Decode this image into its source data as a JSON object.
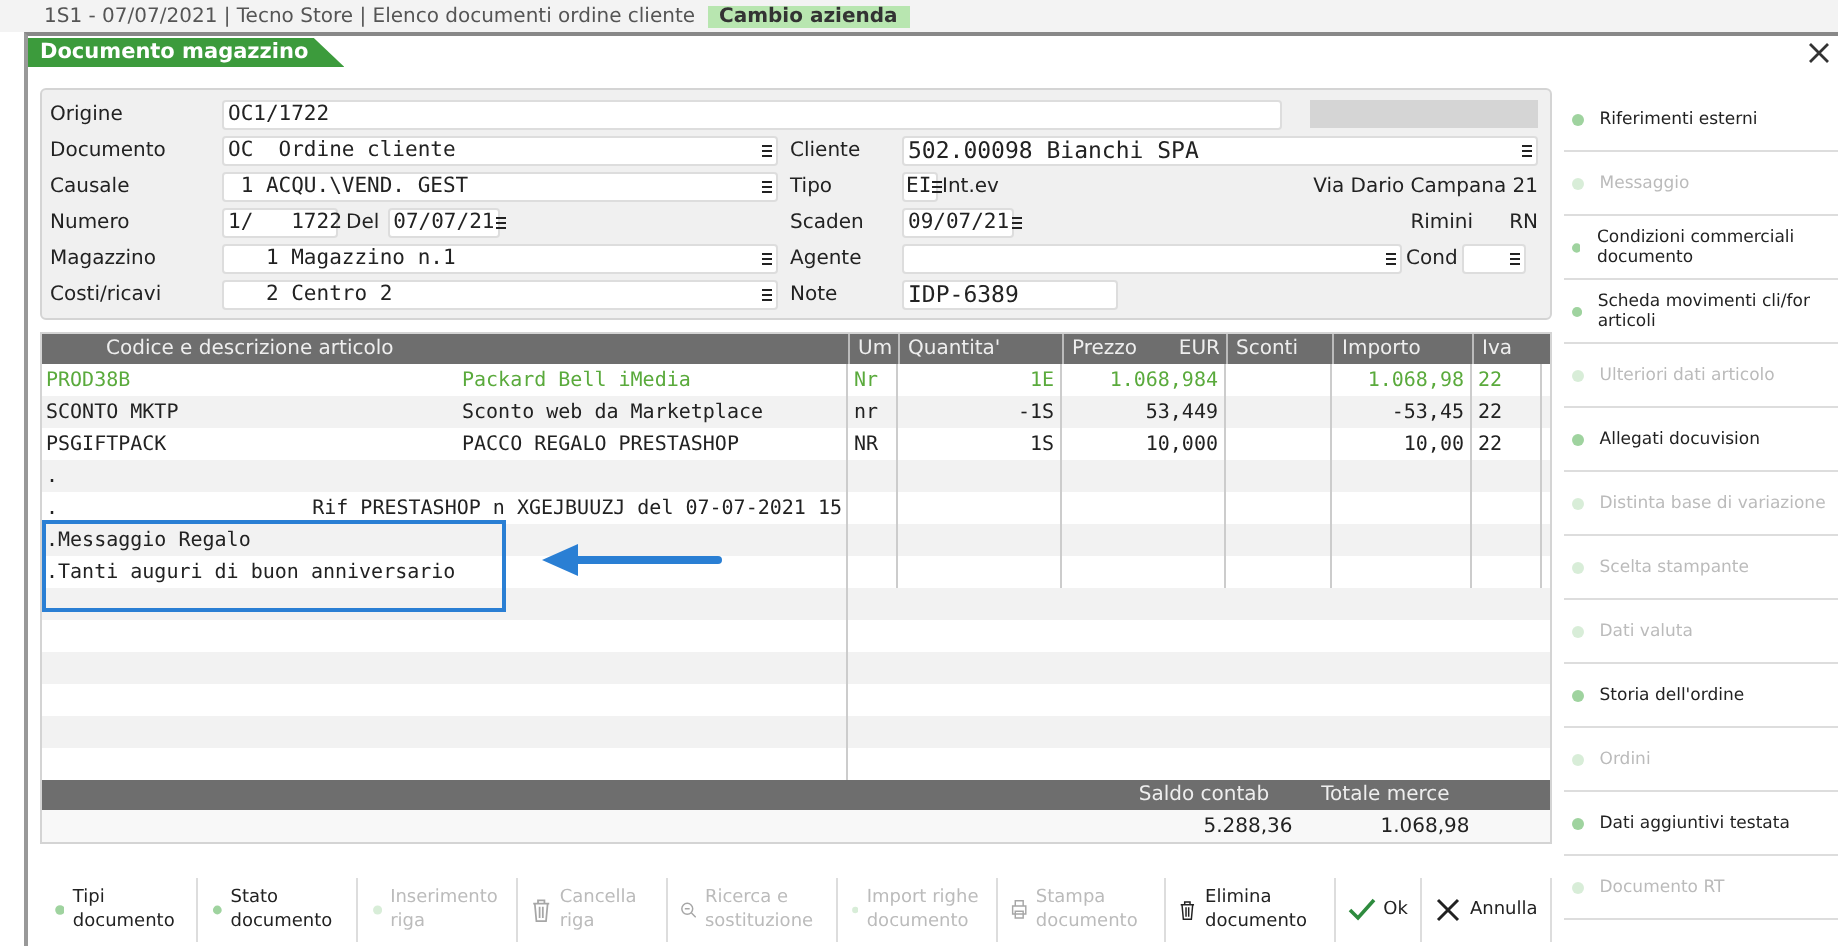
{
  "background_window": {
    "title": "1S1 - 07/07/2021 | Tecno Store | Elenco documenti ordine cliente",
    "action": "Cambio azienda"
  },
  "window": {
    "title": "Documento magazzino"
  },
  "form": {
    "origine": {
      "label": "Origine",
      "value": "OC1/1722"
    },
    "left": [
      {
        "label": "Documento",
        "value": "OC  Ordine cliente",
        "kind": "list"
      },
      {
        "label": "Causale",
        "value": " 1 ACQU.\\VEND. GEST",
        "kind": "list"
      },
      {
        "label": "Numero",
        "value": "1/   1722",
        "kind": "number",
        "date_label": "Del",
        "date": "07/07/21"
      },
      {
        "label": "Magazzino",
        "value": "   1 Magazzino n.1",
        "kind": "list"
      },
      {
        "label": "Costi/ricavi",
        "value": "   2 Centro 2",
        "kind": "list"
      }
    ],
    "right": [
      {
        "label": "Cliente",
        "value": "502.00098 Bianchi SPA",
        "kind": "list"
      },
      {
        "label": "Tipo",
        "value": "EI",
        "kind": "code",
        "text": "Int.ev",
        "extra": [
          "Via Dario Campana 21"
        ]
      },
      {
        "label": "Scaden",
        "value": "09/07/21",
        "kind": "date",
        "extra": [
          "Rimini",
          "RN"
        ]
      },
      {
        "label": "Agente",
        "kind": "agent",
        "cond_label": "Cond"
      },
      {
        "label": "Note",
        "value": "IDP-6389",
        "kind": "text"
      }
    ]
  },
  "table": {
    "columns": [
      "Codice e descrizione articolo",
      "Um",
      "Quantita'",
      "Prezzo",
      "EUR",
      "Sconti",
      "Importo",
      "Iva"
    ],
    "rows": [
      {
        "code": "PROD38B",
        "description": "Packard Bell iMedia",
        "um": "Nr",
        "quantity": "1E",
        "price": "1.068,984",
        "discount": "",
        "amount": "1.068,98",
        "vat": "22",
        "highlight": true,
        "boxed": false,
        "more": false
      },
      {
        "code": "SCONTO MKTP",
        "description": "Sconto web da Marketplace",
        "um": "nr",
        "quantity": "-1S",
        "price": "53,449",
        "discount": "",
        "amount": "-53,45",
        "vat": "22",
        "highlight": false,
        "boxed": false,
        "more": false
      },
      {
        "code": "PSGIFTPACK",
        "description": "PACCO REGALO PRESTASHOP",
        "um": "NR",
        "quantity": "1S",
        "price": "10,000",
        "discount": "",
        "amount": "10,00",
        "vat": "22",
        "highlight": false,
        "boxed": false,
        "more": false
      },
      {
        "code": ".",
        "description": "",
        "um": "",
        "quantity": "",
        "price": "",
        "discount": "",
        "amount": "",
        "vat": "",
        "highlight": false,
        "boxed": false,
        "more": false
      },
      {
        "code": ".",
        "description": "Rif PRESTASHOP n XGEJBUUZJ del 07-07-2021 15",
        "um": "",
        "quantity": "",
        "price": "",
        "discount": "",
        "amount": "",
        "vat": "",
        "highlight": false,
        "boxed": false,
        "more": true
      },
      {
        "code": ".Messaggio Regalo",
        "description": "",
        "um": "",
        "quantity": "",
        "price": "",
        "discount": "",
        "amount": "",
        "vat": "",
        "highlight": false,
        "boxed": true,
        "more": false
      },
      {
        "code": ".Tanti auguri di buon anniversario",
        "description": "",
        "um": "",
        "quantity": "",
        "price": "",
        "discount": "",
        "amount": "",
        "vat": "",
        "highlight": false,
        "boxed": true,
        "more": false
      }
    ]
  },
  "totals": {
    "labels": [
      "Saldo contab",
      "Totale merce"
    ],
    "values": [
      "5.288,36",
      "1.068,98"
    ]
  },
  "toolbar": [
    {
      "label": "Tipi documento",
      "kind": "dot",
      "disabled": false
    },
    {
      "label": "Stato documento",
      "kind": "dot",
      "disabled": false
    },
    {
      "label": "Inserimento riga",
      "kind": "dot",
      "disabled": true
    },
    {
      "label": "Cancella riga",
      "kind": "trash",
      "disabled": true
    },
    {
      "label": "Ricerca e sostituzione",
      "kind": "search",
      "disabled": true
    },
    {
      "label": "Import righe documento",
      "kind": "dot",
      "disabled": true
    },
    {
      "label": "Stampa documento",
      "kind": "print",
      "disabled": true
    },
    {
      "label": "Elimina documento",
      "kind": "trash",
      "disabled": false
    },
    {
      "label": "Ok",
      "kind": "check",
      "disabled": false
    },
    {
      "label": "Annulla",
      "kind": "cross",
      "disabled": false
    }
  ],
  "sidebar": {
    "items": [
      {
        "label": "Riferimenti esterni",
        "disabled": false
      },
      {
        "label": "Messaggio",
        "disabled": true
      },
      {
        "label": "Condizioni commerciali documento",
        "disabled": false
      },
      {
        "label": "Scheda movimenti cli/for articoli",
        "disabled": false
      },
      {
        "label": "Ulteriori dati articolo",
        "disabled": true
      },
      {
        "label": "Allegati docuvision",
        "disabled": false
      },
      {
        "label": "Distinta base di variazione",
        "disabled": true
      },
      {
        "label": "Scelta stampante",
        "disabled": true
      },
      {
        "label": "Dati valuta",
        "disabled": true
      },
      {
        "label": "Storia dell'ordine",
        "disabled": false
      },
      {
        "label": "Ordini",
        "disabled": true
      },
      {
        "label": "Dati aggiuntivi testata",
        "disabled": false
      },
      {
        "label": "Documento RT",
        "disabled": true
      }
    ]
  }
}
